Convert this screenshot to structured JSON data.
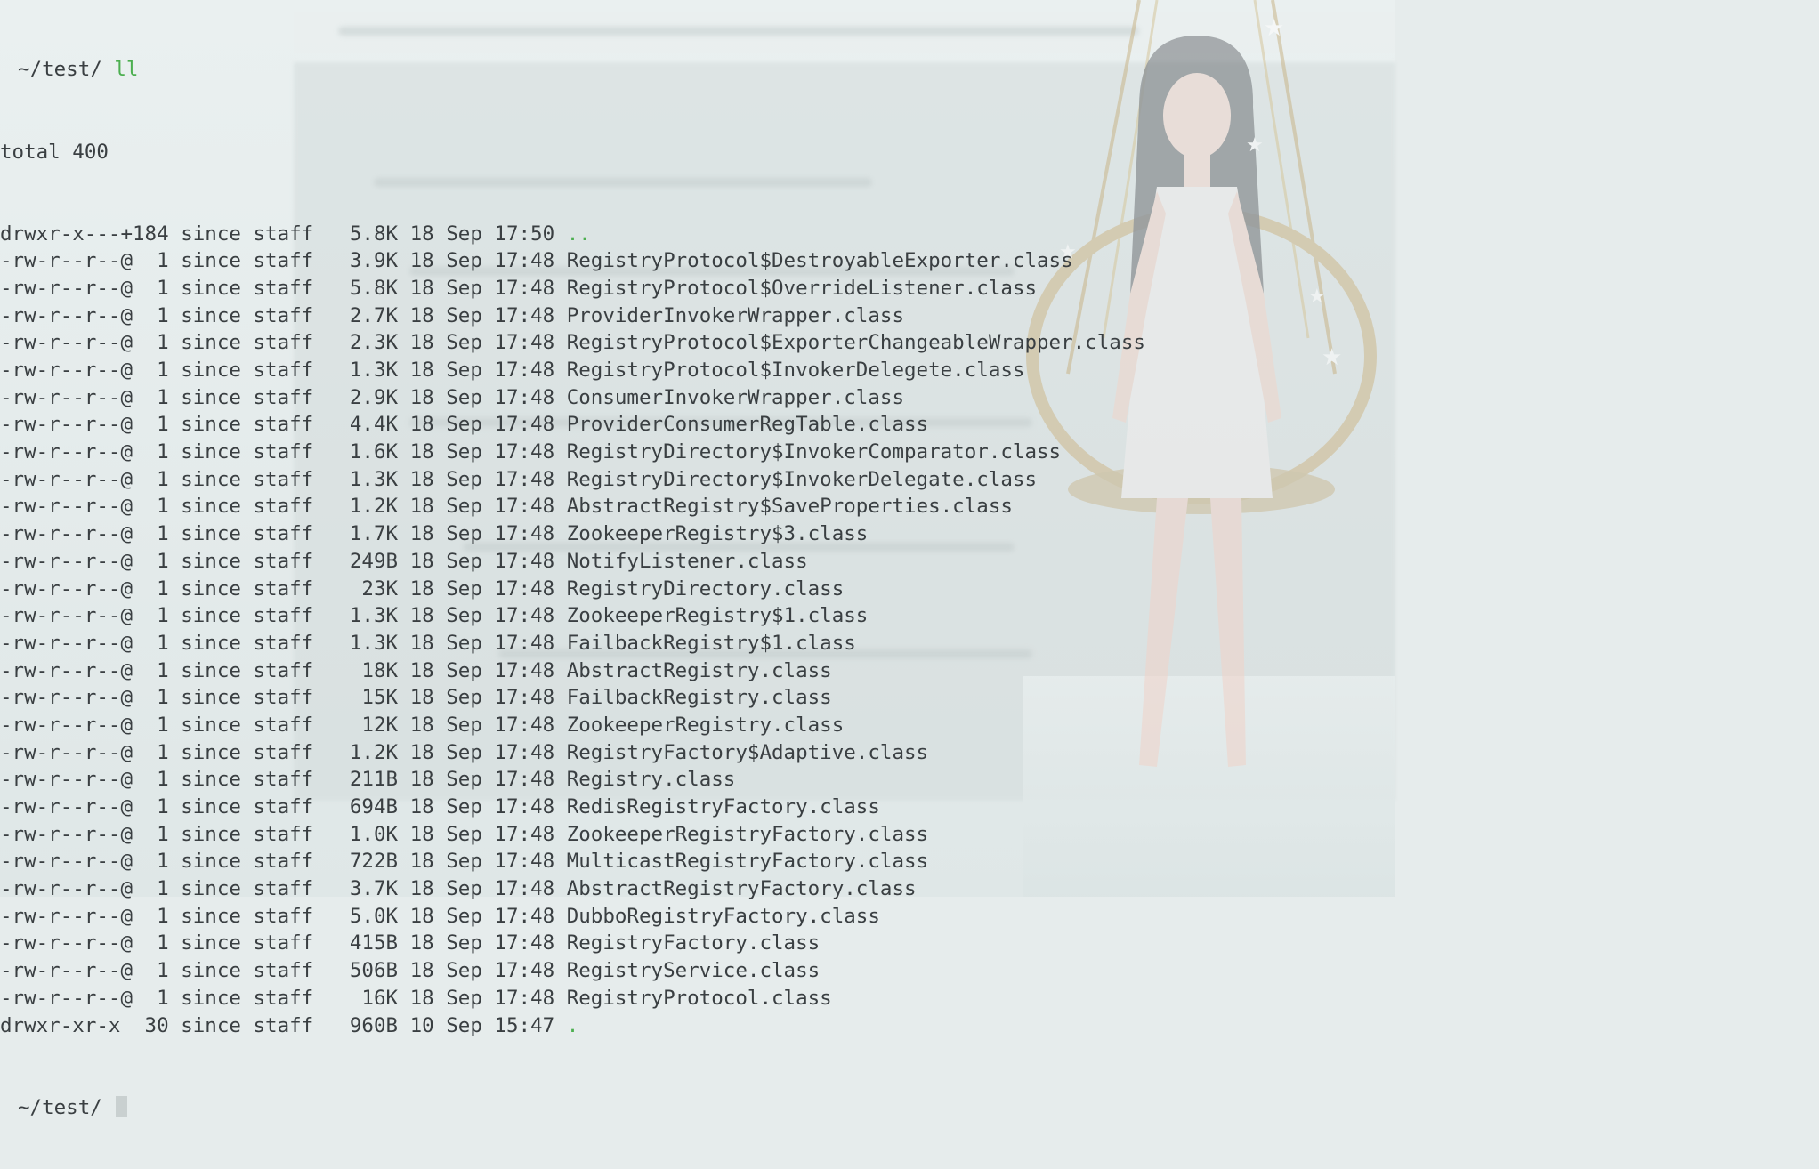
{
  "prompt": {
    "symbol": "",
    "cwd": "~/test/",
    "command": "ll"
  },
  "total": "total 400",
  "entries": [
    {
      "perm": "drwxr-x---+",
      "links": "184",
      "user": "since",
      "group": "staff",
      "size": "5.8K",
      "day": "18",
      "month": "Sep",
      "time": "17:50",
      "name": ".."
    },
    {
      "perm": "-rw-r--r--@",
      "links": "1",
      "user": "since",
      "group": "staff",
      "size": "3.9K",
      "day": "18",
      "month": "Sep",
      "time": "17:48",
      "name": "RegistryProtocol$DestroyableExporter.class"
    },
    {
      "perm": "-rw-r--r--@",
      "links": "1",
      "user": "since",
      "group": "staff",
      "size": "5.8K",
      "day": "18",
      "month": "Sep",
      "time": "17:48",
      "name": "RegistryProtocol$OverrideListener.class"
    },
    {
      "perm": "-rw-r--r--@",
      "links": "1",
      "user": "since",
      "group": "staff",
      "size": "2.7K",
      "day": "18",
      "month": "Sep",
      "time": "17:48",
      "name": "ProviderInvokerWrapper.class"
    },
    {
      "perm": "-rw-r--r--@",
      "links": "1",
      "user": "since",
      "group": "staff",
      "size": "2.3K",
      "day": "18",
      "month": "Sep",
      "time": "17:48",
      "name": "RegistryProtocol$ExporterChangeableWrapper.class"
    },
    {
      "perm": "-rw-r--r--@",
      "links": "1",
      "user": "since",
      "group": "staff",
      "size": "1.3K",
      "day": "18",
      "month": "Sep",
      "time": "17:48",
      "name": "RegistryProtocol$InvokerDelegete.class"
    },
    {
      "perm": "-rw-r--r--@",
      "links": "1",
      "user": "since",
      "group": "staff",
      "size": "2.9K",
      "day": "18",
      "month": "Sep",
      "time": "17:48",
      "name": "ConsumerInvokerWrapper.class"
    },
    {
      "perm": "-rw-r--r--@",
      "links": "1",
      "user": "since",
      "group": "staff",
      "size": "4.4K",
      "day": "18",
      "month": "Sep",
      "time": "17:48",
      "name": "ProviderConsumerRegTable.class"
    },
    {
      "perm": "-rw-r--r--@",
      "links": "1",
      "user": "since",
      "group": "staff",
      "size": "1.6K",
      "day": "18",
      "month": "Sep",
      "time": "17:48",
      "name": "RegistryDirectory$InvokerComparator.class"
    },
    {
      "perm": "-rw-r--r--@",
      "links": "1",
      "user": "since",
      "group": "staff",
      "size": "1.3K",
      "day": "18",
      "month": "Sep",
      "time": "17:48",
      "name": "RegistryDirectory$InvokerDelegate.class"
    },
    {
      "perm": "-rw-r--r--@",
      "links": "1",
      "user": "since",
      "group": "staff",
      "size": "1.2K",
      "day": "18",
      "month": "Sep",
      "time": "17:48",
      "name": "AbstractRegistry$SaveProperties.class"
    },
    {
      "perm": "-rw-r--r--@",
      "links": "1",
      "user": "since",
      "group": "staff",
      "size": "1.7K",
      "day": "18",
      "month": "Sep",
      "time": "17:48",
      "name": "ZookeeperRegistry$3.class"
    },
    {
      "perm": "-rw-r--r--@",
      "links": "1",
      "user": "since",
      "group": "staff",
      "size": "249B",
      "day": "18",
      "month": "Sep",
      "time": "17:48",
      "name": "NotifyListener.class"
    },
    {
      "perm": "-rw-r--r--@",
      "links": "1",
      "user": "since",
      "group": "staff",
      "size": "23K",
      "day": "18",
      "month": "Sep",
      "time": "17:48",
      "name": "RegistryDirectory.class"
    },
    {
      "perm": "-rw-r--r--@",
      "links": "1",
      "user": "since",
      "group": "staff",
      "size": "1.3K",
      "day": "18",
      "month": "Sep",
      "time": "17:48",
      "name": "ZookeeperRegistry$1.class"
    },
    {
      "perm": "-rw-r--r--@",
      "links": "1",
      "user": "since",
      "group": "staff",
      "size": "1.3K",
      "day": "18",
      "month": "Sep",
      "time": "17:48",
      "name": "FailbackRegistry$1.class"
    },
    {
      "perm": "-rw-r--r--@",
      "links": "1",
      "user": "since",
      "group": "staff",
      "size": "18K",
      "day": "18",
      "month": "Sep",
      "time": "17:48",
      "name": "AbstractRegistry.class"
    },
    {
      "perm": "-rw-r--r--@",
      "links": "1",
      "user": "since",
      "group": "staff",
      "size": "15K",
      "day": "18",
      "month": "Sep",
      "time": "17:48",
      "name": "FailbackRegistry.class"
    },
    {
      "perm": "-rw-r--r--@",
      "links": "1",
      "user": "since",
      "group": "staff",
      "size": "12K",
      "day": "18",
      "month": "Sep",
      "time": "17:48",
      "name": "ZookeeperRegistry.class"
    },
    {
      "perm": "-rw-r--r--@",
      "links": "1",
      "user": "since",
      "group": "staff",
      "size": "1.2K",
      "day": "18",
      "month": "Sep",
      "time": "17:48",
      "name": "RegistryFactory$Adaptive.class"
    },
    {
      "perm": "-rw-r--r--@",
      "links": "1",
      "user": "since",
      "group": "staff",
      "size": "211B",
      "day": "18",
      "month": "Sep",
      "time": "17:48",
      "name": "Registry.class"
    },
    {
      "perm": "-rw-r--r--@",
      "links": "1",
      "user": "since",
      "group": "staff",
      "size": "694B",
      "day": "18",
      "month": "Sep",
      "time": "17:48",
      "name": "RedisRegistryFactory.class"
    },
    {
      "perm": "-rw-r--r--@",
      "links": "1",
      "user": "since",
      "group": "staff",
      "size": "1.0K",
      "day": "18",
      "month": "Sep",
      "time": "17:48",
      "name": "ZookeeperRegistryFactory.class"
    },
    {
      "perm": "-rw-r--r--@",
      "links": "1",
      "user": "since",
      "group": "staff",
      "size": "722B",
      "day": "18",
      "month": "Sep",
      "time": "17:48",
      "name": "MulticastRegistryFactory.class"
    },
    {
      "perm": "-rw-r--r--@",
      "links": "1",
      "user": "since",
      "group": "staff",
      "size": "3.7K",
      "day": "18",
      "month": "Sep",
      "time": "17:48",
      "name": "AbstractRegistryFactory.class"
    },
    {
      "perm": "-rw-r--r--@",
      "links": "1",
      "user": "since",
      "group": "staff",
      "size": "5.0K",
      "day": "18",
      "month": "Sep",
      "time": "17:48",
      "name": "DubboRegistryFactory.class"
    },
    {
      "perm": "-rw-r--r--@",
      "links": "1",
      "user": "since",
      "group": "staff",
      "size": "415B",
      "day": "18",
      "month": "Sep",
      "time": "17:48",
      "name": "RegistryFactory.class"
    },
    {
      "perm": "-rw-r--r--@",
      "links": "1",
      "user": "since",
      "group": "staff",
      "size": "506B",
      "day": "18",
      "month": "Sep",
      "time": "17:48",
      "name": "RegistryService.class"
    },
    {
      "perm": "-rw-r--r--@",
      "links": "1",
      "user": "since",
      "group": "staff",
      "size": "16K",
      "day": "18",
      "month": "Sep",
      "time": "17:48",
      "name": "RegistryProtocol.class"
    },
    {
      "perm": "drwxr-xr-x",
      "links": "30",
      "user": "since",
      "group": "staff",
      "size": "960B",
      "day": "10",
      "month": "Sep",
      "time": "15:47",
      "name": "."
    }
  ],
  "colors": {
    "background": "#e6ecec",
    "text": "#3a3f42",
    "command": "#4caf50",
    "directory_name": "#4caf50",
    "prompt_symbol": "#c2255c",
    "cursor": "#c9d0d0"
  }
}
